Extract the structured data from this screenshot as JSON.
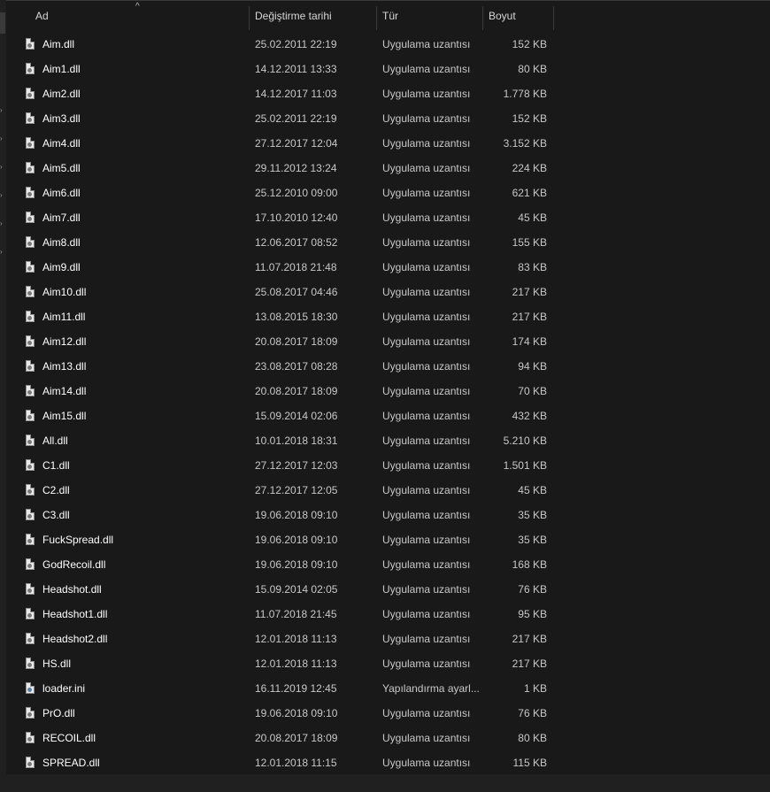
{
  "columns": {
    "name": "Ad",
    "date": "Değiştirme tarihi",
    "type": "Tür",
    "size": "Boyut"
  },
  "sort_indicator": "^",
  "files": [
    {
      "name": "Aim.dll",
      "date": "25.02.2011 22:19",
      "type": "Uygulama uzantısı",
      "size": "152 KB",
      "icon": "dll-file-icon"
    },
    {
      "name": "Aim1.dll",
      "date": "14.12.2011 13:33",
      "type": "Uygulama uzantısı",
      "size": "80 KB",
      "icon": "dll-file-icon"
    },
    {
      "name": "Aim2.dll",
      "date": "14.12.2017 11:03",
      "type": "Uygulama uzantısı",
      "size": "1.778 KB",
      "icon": "dll-file-icon"
    },
    {
      "name": "Aim3.dll",
      "date": "25.02.2011 22:19",
      "type": "Uygulama uzantısı",
      "size": "152 KB",
      "icon": "dll-file-icon"
    },
    {
      "name": "Aim4.dll",
      "date": "27.12.2017 12:04",
      "type": "Uygulama uzantısı",
      "size": "3.152 KB",
      "icon": "dll-file-icon"
    },
    {
      "name": "Aim5.dll",
      "date": "29.11.2012 13:24",
      "type": "Uygulama uzantısı",
      "size": "224 KB",
      "icon": "dll-file-icon"
    },
    {
      "name": "Aim6.dll",
      "date": "25.12.2010 09:00",
      "type": "Uygulama uzantısı",
      "size": "621 KB",
      "icon": "dll-file-icon"
    },
    {
      "name": "Aim7.dll",
      "date": "17.10.2010 12:40",
      "type": "Uygulama uzantısı",
      "size": "45 KB",
      "icon": "dll-file-icon"
    },
    {
      "name": "Aim8.dll",
      "date": "12.06.2017 08:52",
      "type": "Uygulama uzantısı",
      "size": "155 KB",
      "icon": "dll-file-icon"
    },
    {
      "name": "Aim9.dll",
      "date": "11.07.2018 21:48",
      "type": "Uygulama uzantısı",
      "size": "83 KB",
      "icon": "dll-file-icon"
    },
    {
      "name": "Aim10.dll",
      "date": "25.08.2017 04:46",
      "type": "Uygulama uzantısı",
      "size": "217 KB",
      "icon": "dll-file-icon"
    },
    {
      "name": "Aim11.dll",
      "date": "13.08.2015 18:30",
      "type": "Uygulama uzantısı",
      "size": "217 KB",
      "icon": "dll-file-icon"
    },
    {
      "name": "Aim12.dll",
      "date": "20.08.2017 18:09",
      "type": "Uygulama uzantısı",
      "size": "174 KB",
      "icon": "dll-file-icon"
    },
    {
      "name": "Aim13.dll",
      "date": "23.08.2017 08:28",
      "type": "Uygulama uzantısı",
      "size": "94 KB",
      "icon": "dll-file-icon"
    },
    {
      "name": "Aim14.dll",
      "date": "20.08.2017 18:09",
      "type": "Uygulama uzantısı",
      "size": "70 KB",
      "icon": "dll-file-icon"
    },
    {
      "name": "Aim15.dll",
      "date": "15.09.2014 02:06",
      "type": "Uygulama uzantısı",
      "size": "432 KB",
      "icon": "dll-file-icon"
    },
    {
      "name": "All.dll",
      "date": "10.01.2018 18:31",
      "type": "Uygulama uzantısı",
      "size": "5.210 KB",
      "icon": "dll-file-icon"
    },
    {
      "name": "C1.dll",
      "date": "27.12.2017 12:03",
      "type": "Uygulama uzantısı",
      "size": "1.501 KB",
      "icon": "dll-file-icon"
    },
    {
      "name": "C2.dll",
      "date": "27.12.2017 12:05",
      "type": "Uygulama uzantısı",
      "size": "45 KB",
      "icon": "dll-file-icon"
    },
    {
      "name": "C3.dll",
      "date": "19.06.2018 09:10",
      "type": "Uygulama uzantısı",
      "size": "35 KB",
      "icon": "dll-file-icon"
    },
    {
      "name": "FuckSpread.dll",
      "date": "19.06.2018 09:10",
      "type": "Uygulama uzantısı",
      "size": "35 KB",
      "icon": "dll-file-icon"
    },
    {
      "name": "GodRecoil.dll",
      "date": "19.06.2018 09:10",
      "type": "Uygulama uzantısı",
      "size": "168 KB",
      "icon": "dll-file-icon"
    },
    {
      "name": "Headshot.dll",
      "date": "15.09.2014 02:05",
      "type": "Uygulama uzantısı",
      "size": "76 KB",
      "icon": "dll-file-icon"
    },
    {
      "name": "Headshot1.dll",
      "date": "11.07.2018 21:45",
      "type": "Uygulama uzantısı",
      "size": "95 KB",
      "icon": "dll-file-icon"
    },
    {
      "name": "Headshot2.dll",
      "date": "12.01.2018 11:13",
      "type": "Uygulama uzantısı",
      "size": "217 KB",
      "icon": "dll-file-icon"
    },
    {
      "name": "HS.dll",
      "date": "12.01.2018 11:13",
      "type": "Uygulama uzantısı",
      "size": "217 KB",
      "icon": "dll-file-icon"
    },
    {
      "name": "loader.ini",
      "date": "16.11.2019 12:45",
      "type": "Yapılandırma ayarl...",
      "size": "1 KB",
      "icon": "ini-file-icon"
    },
    {
      "name": "PrO.dll",
      "date": "19.06.2018 09:10",
      "type": "Uygulama uzantısı",
      "size": "76 KB",
      "icon": "dll-file-icon"
    },
    {
      "name": "RECOIL.dll",
      "date": "20.08.2017 18:09",
      "type": "Uygulama uzantısı",
      "size": "80 KB",
      "icon": "dll-file-icon"
    },
    {
      "name": "SPREAD.dll",
      "date": "12.01.2018 11:15",
      "type": "Uygulama uzantısı",
      "size": "115 KB",
      "icon": "dll-file-icon"
    }
  ],
  "colors": {
    "background": "#191919",
    "text": "#ffffff",
    "secondary_text": "#c8c8c8",
    "separator": "#3a3a3a"
  }
}
